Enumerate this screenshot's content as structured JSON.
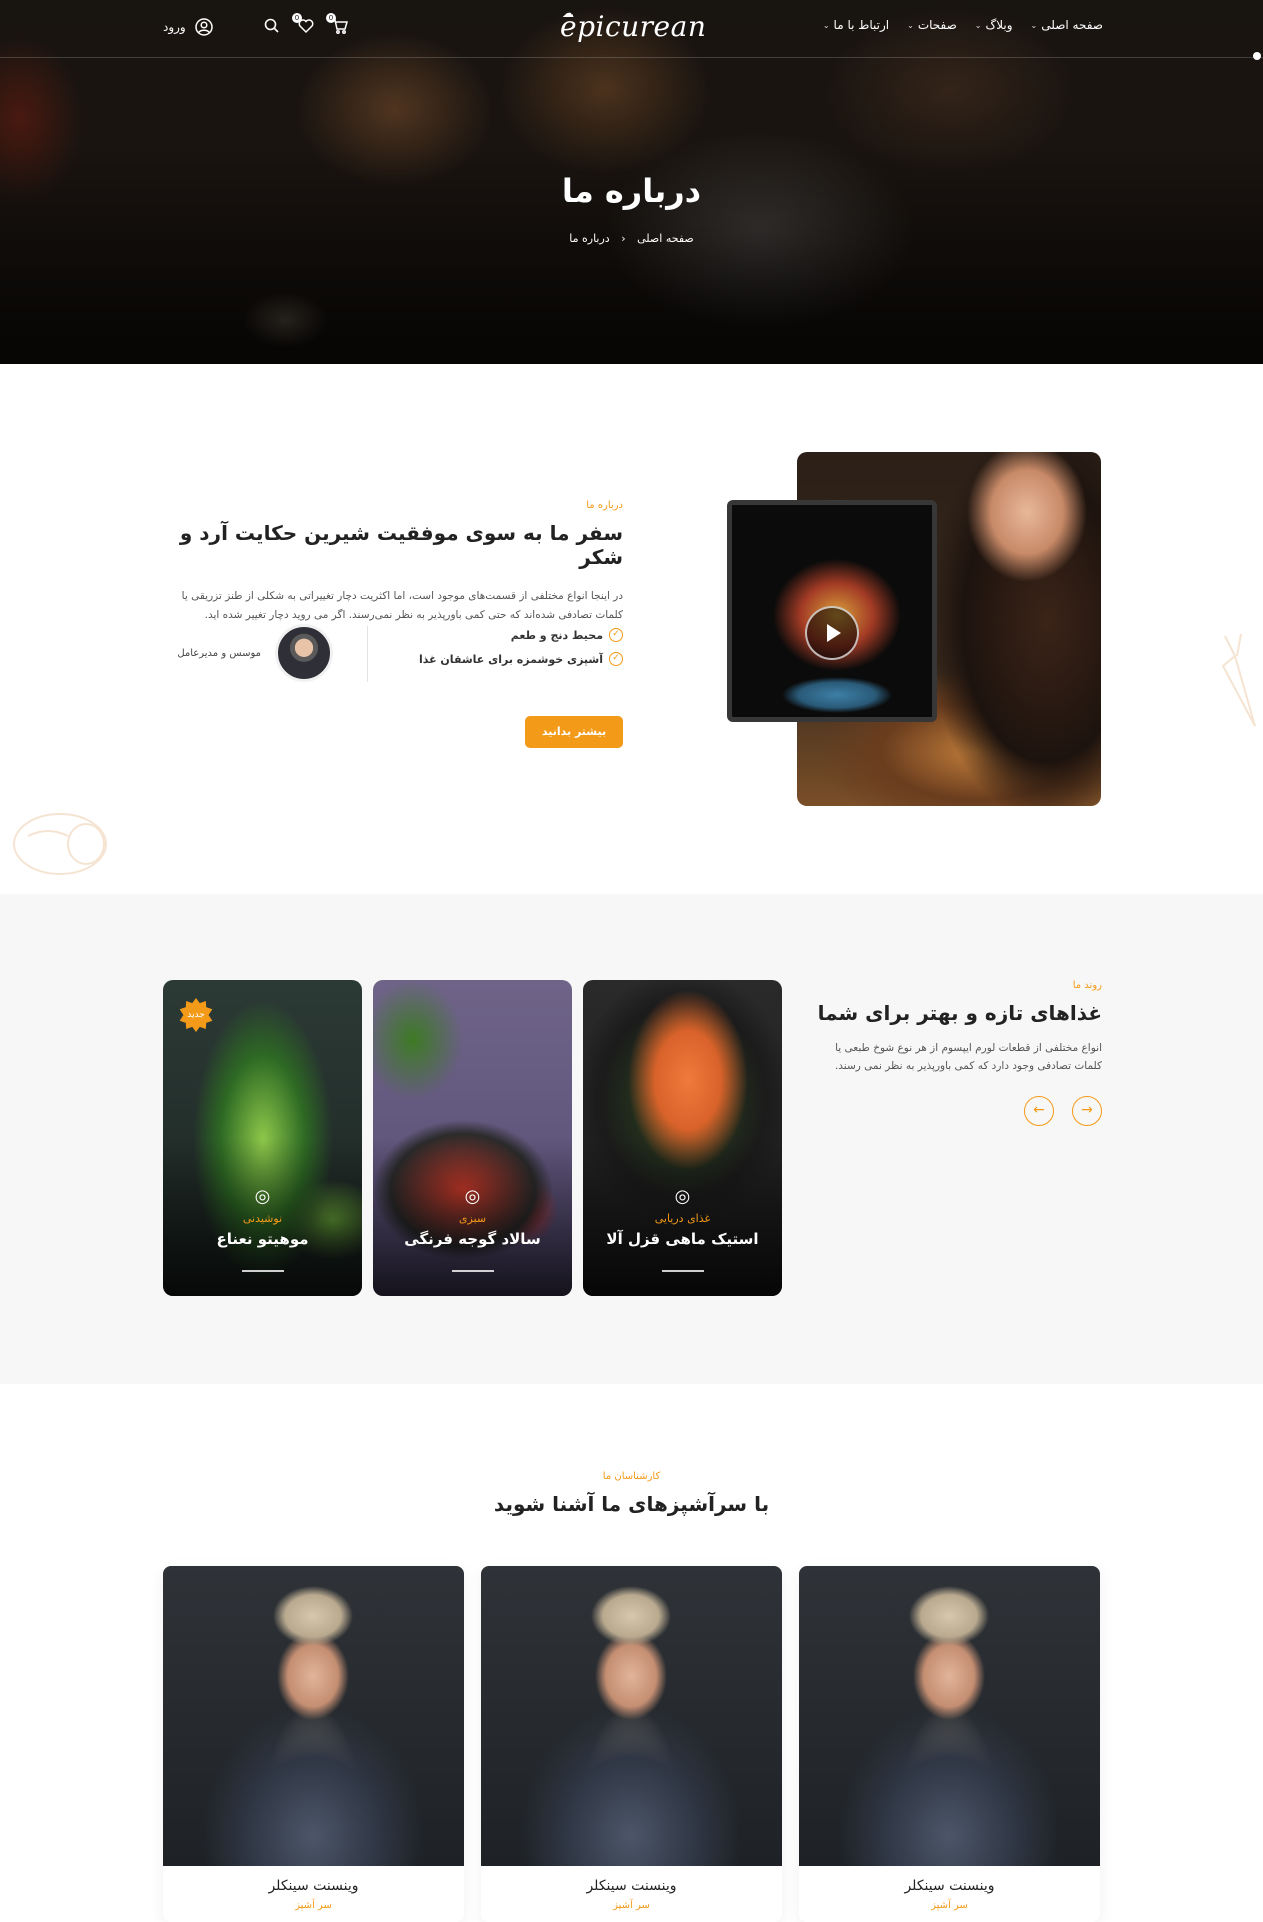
{
  "brand": {
    "logo": "epicurean",
    "accent": "#f39a18"
  },
  "nav": {
    "items": [
      {
        "label": "صفحه اصلی",
        "icon": "chevron-down-icon"
      },
      {
        "label": "وبلاگ",
        "icon": "chevron-down-icon"
      },
      {
        "label": "صفحات",
        "icon": "chevron-down-icon"
      },
      {
        "label": "ارتباط با ما",
        "icon": "chevron-down-icon"
      }
    ],
    "icons": [
      "search-icon",
      "heart-icon",
      "cart-icon",
      "user-icon"
    ],
    "wishlist_count": "0",
    "cart_count": "0",
    "login_label": "ورود"
  },
  "hero": {
    "title": "درباره ما",
    "breadcrumb": {
      "home": "صفحه اصلی",
      "separator": "‹",
      "current": "درباره ما"
    }
  },
  "about": {
    "eyebrow": "درباره ما",
    "heading": "سفر ما به سوی موفقیت شیرین حکایت آرد و شکر",
    "paragraph": "در اینجا انواع مختلفی از قسمت‌های موجود است، اما اکثریت دچار تغییراتی به شکلی از طنز تزریقی یا کلمات تصادفی شده‌اند که حتی کمی باورپذیر به نظر نمی‌رسند. اگر می روید دچار تغییر شده اید.",
    "features": [
      "محیط دنج و طعم",
      "آشپزی خوشمزه برای عاشقان غذا"
    ],
    "founder_title": "موسس و مدیرعامل",
    "cta_label": "بیشتر بدانید"
  },
  "foods": {
    "eyebrow": "روند ما",
    "heading": "غذاهای تازه و بهتر برای شما",
    "paragraph": "انواع مختلفی از قطعات لورم ایپسوم از هر نوع شوخ طبعی یا کلمات تصادفی وجود دارد که کمی باورپذیر به نظر نمی رسند.",
    "items": [
      {
        "name": "استیک ماهی قزل آلا",
        "category": "غذای دریایی",
        "icon": "seafood-icon",
        "badge": ""
      },
      {
        "name": "سالاد گوجه فرنگی",
        "category": "سبزی",
        "icon": "salad-icon",
        "badge": ""
      },
      {
        "name": "موهیتو نعناع",
        "category": "نوشیدنی",
        "icon": "drink-icon",
        "badge": "جدید"
      }
    ]
  },
  "chefs": {
    "eyebrow": "کارشناسان ما",
    "heading": "با سرآشپزهای ما آشنا شوید",
    "items": [
      {
        "name": "وینسنت سینکلر",
        "role": "سر آشپز"
      },
      {
        "name": "وینسنت سینکلر",
        "role": "سر آشپز"
      },
      {
        "name": "وینسنت سینکلر",
        "role": "سر آشپز"
      }
    ]
  }
}
